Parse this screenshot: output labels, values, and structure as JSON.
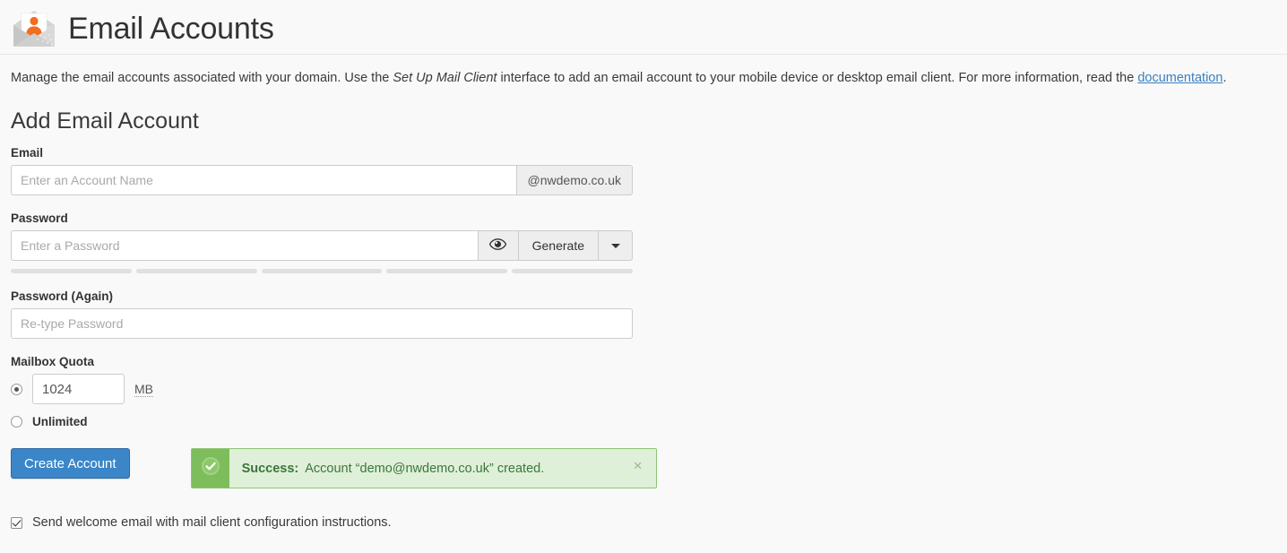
{
  "header": {
    "title": "Email Accounts",
    "icon": "email-account-icon"
  },
  "description": {
    "part1": "Manage the email accounts associated with your domain. Use the ",
    "emphasis": "Set Up Mail Client",
    "part2": " interface to add an email account to your mobile device or desktop email client. For more information, read the ",
    "link_text": "documentation",
    "part3": "."
  },
  "form": {
    "section_title": "Add Email Account",
    "email": {
      "label": "Email",
      "placeholder": "Enter an Account Name",
      "value": "",
      "domain_addon": "@nwdemo.co.uk"
    },
    "password": {
      "label": "Password",
      "placeholder": "Enter a Password",
      "value": "",
      "show_icon": "eye-icon",
      "generate_label": "Generate",
      "caret_icon": "chevron-down-icon",
      "strength_segments": 5
    },
    "password_again": {
      "label": "Password (Again)",
      "placeholder": "Re-type Password",
      "value": ""
    },
    "quota": {
      "label": "Mailbox Quota",
      "value": "1024",
      "unit": "MB",
      "unit_title": "Megabytes",
      "fixed_selected": true,
      "unlimited_label": "Unlimited",
      "unlimited_selected": false
    },
    "submit_label": "Create Account",
    "welcome": {
      "label": "Send welcome email with mail client configuration instructions.",
      "checked": true
    }
  },
  "alert": {
    "icon": "check-circle-icon",
    "strong": "Success:",
    "message": "Account “demo@nwdemo.co.uk” created.",
    "close_label": "×"
  },
  "colors": {
    "primary": "#3a86c8",
    "success_bg": "#dff0d8",
    "success_border": "#8fc474",
    "success_icon_bg": "#7dbd5c",
    "success_text": "#3c763d",
    "link": "#3a7ebf",
    "page_bg": "#f9f9f9",
    "icon_orange": "#f26d21",
    "icon_gray": "#c9c9c9"
  }
}
